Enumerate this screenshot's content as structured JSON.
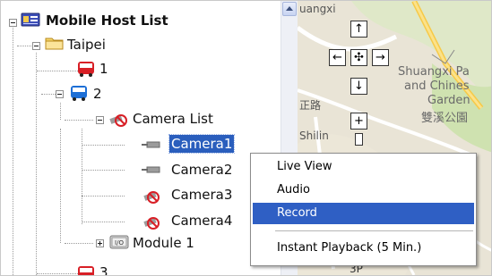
{
  "tree": {
    "root_label": "Mobile Host List",
    "group_label": "Taipei",
    "host1_label": "1",
    "host2_label": "2",
    "camera_list_label": "Camera List",
    "cameras": [
      "Camera1",
      "Camera2",
      "Camera3",
      "Camera4"
    ],
    "module_label": "Module 1",
    "host3_label": "3",
    "module_badge": "I/O"
  },
  "map": {
    "corner_text": "uangxi",
    "place_name_line1": "Shuangxi Pa",
    "place_name_line2": "and Chines",
    "place_name_line3": "Garden",
    "place_name_cn": "雙溪公園",
    "road_text": "正路",
    "district_text": "Shilin",
    "bottom_text": "3P",
    "controls": {
      "up": "↑",
      "left": "←",
      "center": "✣",
      "right": "→",
      "down": "↓",
      "zoom_in": "+"
    }
  },
  "context_menu": {
    "items": [
      "Live View",
      "Audio",
      "Record",
      "Instant Playback (5 Min.)"
    ],
    "highlighted": "Record"
  },
  "colors": {
    "selection": "#2a5ebd",
    "menu_highlight": "#2f5fc4",
    "bus_red": "#d81f26",
    "bus_blue": "#1d6fd6"
  }
}
